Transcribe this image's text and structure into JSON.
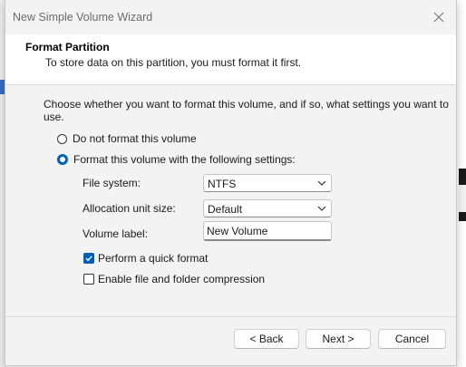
{
  "window": {
    "title": "New Simple Volume Wizard"
  },
  "header": {
    "title": "Format Partition",
    "subtitle": "To store data on this partition, you must format it first."
  },
  "content": {
    "instruction": "Choose whether you want to format this volume, and if so, what settings you want to use.",
    "options": [
      {
        "label": "Do not format this volume",
        "selected": false
      },
      {
        "label": "Format this volume with the following settings:",
        "selected": true
      }
    ],
    "fields": {
      "file_system": {
        "label": "File system:",
        "value": "NTFS"
      },
      "allocation_unit_size": {
        "label": "Allocation unit size:",
        "value": "Default"
      },
      "volume_label": {
        "label": "Volume label:",
        "value": "New Volume"
      }
    },
    "checkboxes": [
      {
        "label": "Perform a quick format",
        "checked": true
      },
      {
        "label": "Enable file and folder compression",
        "checked": false
      }
    ]
  },
  "buttons": {
    "back": "< Back",
    "next": "Next >",
    "cancel": "Cancel"
  },
  "colors": {
    "accent": "#005fb8",
    "dialog_bg": "#f3f3f3",
    "header_bg": "#ffffff"
  },
  "icons": {
    "close": "close-icon",
    "dropdown": "chevron-down-icon",
    "check": "checkmark-icon"
  }
}
